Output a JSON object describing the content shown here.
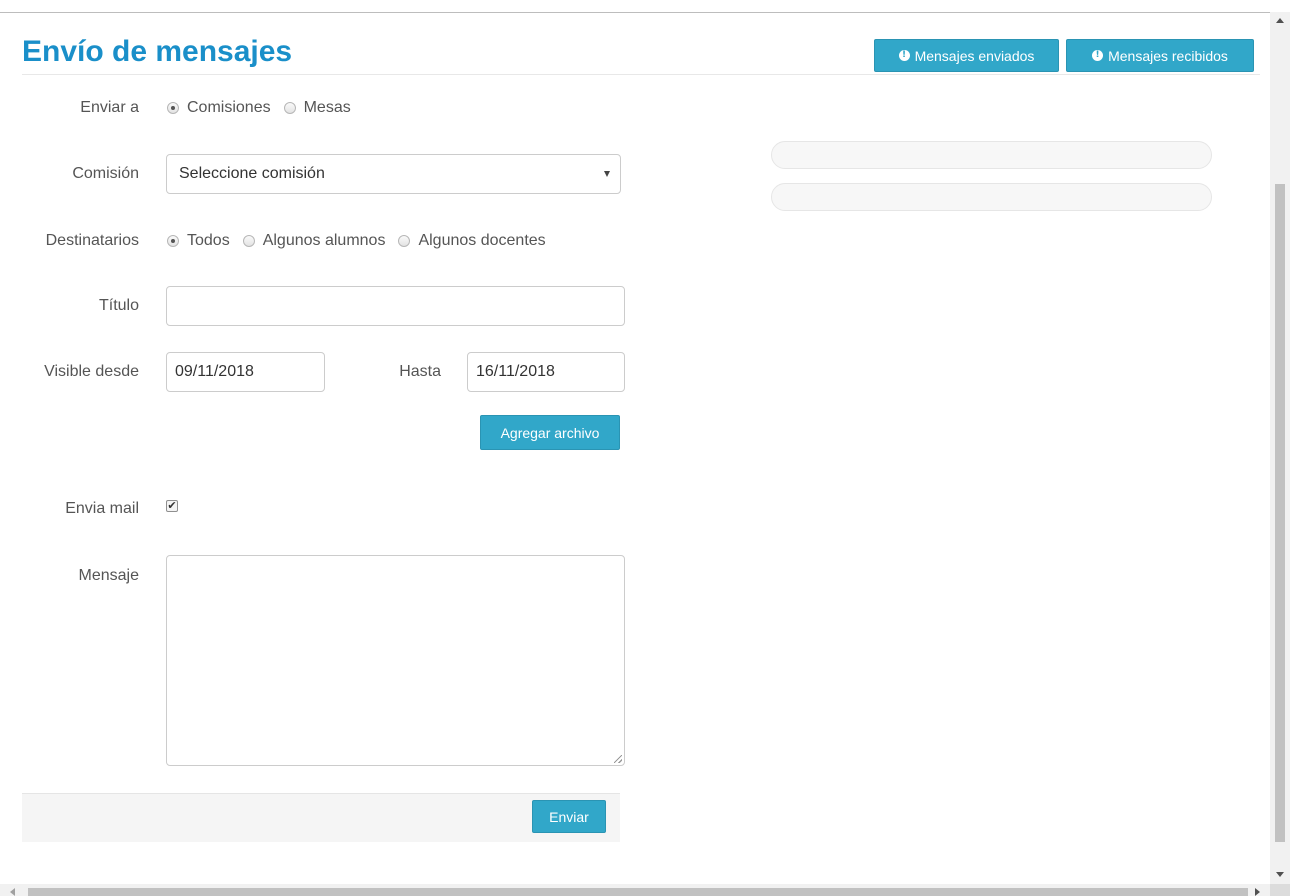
{
  "header": {
    "title": "Envío de mensajes",
    "sent_button": "Mensajes enviados",
    "received_button": "Mensajes recibidos"
  },
  "form": {
    "send_to": {
      "label": "Enviar a",
      "options": [
        "Comisiones",
        "Mesas"
      ],
      "selected": "Comisiones"
    },
    "commission": {
      "label": "Comisión",
      "value": "Seleccione comisión"
    },
    "recipients": {
      "label": "Destinatarios",
      "options": [
        "Todos",
        "Algunos alumnos",
        "Algunos docentes"
      ],
      "selected": "Todos"
    },
    "title": {
      "label": "Título",
      "value": ""
    },
    "visible_from": {
      "label": "Visible desde",
      "value": "09/11/2018"
    },
    "until": {
      "label": "Hasta",
      "value": "16/11/2018"
    },
    "attach_button": "Agregar archivo",
    "send_mail": {
      "label": "Envia mail",
      "checked": true
    },
    "message": {
      "label": "Mensaje",
      "value": ""
    },
    "submit_button": "Enviar"
  },
  "colors": {
    "accent": "#1a8fc9",
    "button": "#31a7c9"
  }
}
